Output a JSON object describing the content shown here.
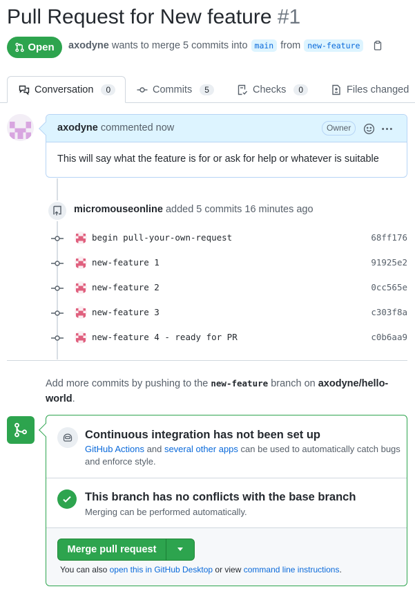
{
  "pr": {
    "title": "Pull Request for New feature",
    "number": "#1",
    "state": "Open",
    "author": "axodyne",
    "meta_mid": "wants to merge 5 commits into",
    "base": "main",
    "from_word": "from",
    "head": "new-feature"
  },
  "tabs": [
    {
      "label": "Conversation",
      "count": "0"
    },
    {
      "label": "Commits",
      "count": "5"
    },
    {
      "label": "Checks",
      "count": "0"
    },
    {
      "label": "Files changed"
    }
  ],
  "comment": {
    "author": "axodyne",
    "action": "commented now",
    "badge": "Owner",
    "body": "This will say what the feature is for or ask for help or whatever is suitable"
  },
  "push_event": {
    "user": "micromouseonline",
    "text": "added 5 commits 16 minutes ago"
  },
  "commits": [
    {
      "message": "begin pull-your-own-request",
      "sha": "68ff176"
    },
    {
      "message": "new-feature 1",
      "sha": "91925e2"
    },
    {
      "message": "new-feature 2",
      "sha": "0cc565e"
    },
    {
      "message": "new-feature 3",
      "sha": "c303f8a"
    },
    {
      "message": "new-feature 4 - ready for PR",
      "sha": "c0b6aa9"
    }
  ],
  "hint": {
    "pre": "Add more commits by pushing to the",
    "branch": "new-feature",
    "mid": "branch on",
    "repo": "axodyne/hello-world",
    "end": "."
  },
  "merge": {
    "ci_title": "Continuous integration has not been set up",
    "ci_link1": "GitHub Actions",
    "ci_and": "and",
    "ci_link2": "several other apps",
    "ci_rest": "can be used to automatically catch bugs and enforce style.",
    "conflict_title": "This branch has no conflicts with the base branch",
    "conflict_sub": "Merging can be performed automatically.",
    "button": "Merge pull request",
    "also_pre": "You can also",
    "also_link1": "open this in GitHub Desktop",
    "also_mid": "or view",
    "also_link2": "command line instructions",
    "also_end": "."
  },
  "colors": {
    "green": "#2da44e",
    "link": "#0969da",
    "branch_bg": "#ddf4ff"
  }
}
